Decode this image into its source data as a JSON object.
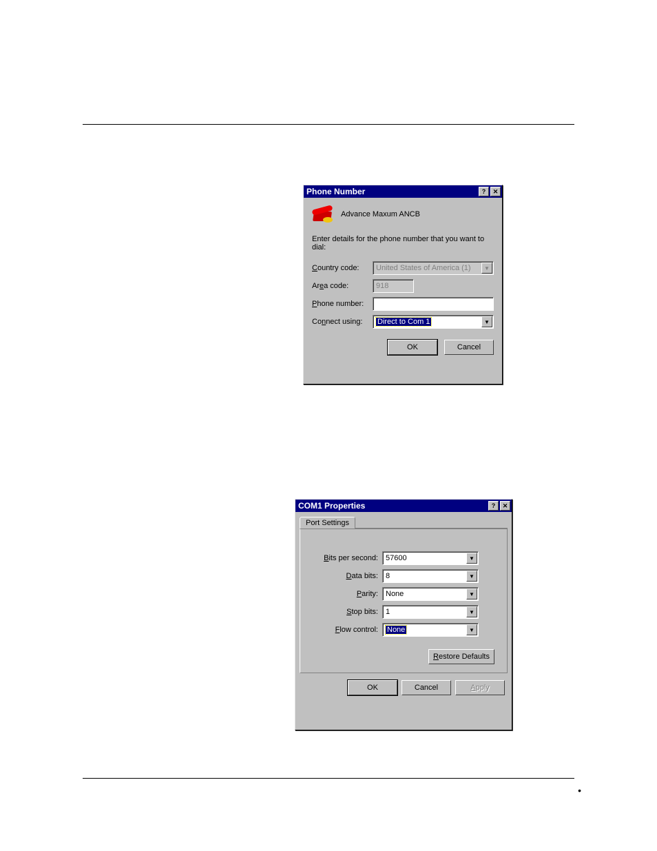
{
  "phone_dialog": {
    "title": "Phone Number",
    "icon_name": "Advance Maxum ANCB",
    "instruction": "Enter details for the phone number that you want to dial:",
    "country": {
      "label": "Country code:",
      "value": "United States of America (1)"
    },
    "area": {
      "label": "Area code:",
      "value": "918"
    },
    "number": {
      "label": "Phone number:",
      "value": ""
    },
    "connect": {
      "label": "Connect using:",
      "value": "Direct to Com 1"
    },
    "ok": "OK",
    "cancel": "Cancel"
  },
  "com_dialog": {
    "title": "COM1 Properties",
    "tab": "Port Settings",
    "bps": {
      "label": "Bits per second:",
      "value": "57600"
    },
    "dbits": {
      "label": "Data bits:",
      "value": "8"
    },
    "parity": {
      "label": "Parity:",
      "value": "None"
    },
    "sbits": {
      "label": "Stop bits:",
      "value": "1"
    },
    "flow": {
      "label": "Flow control:",
      "value": "None"
    },
    "restore": "Restore Defaults",
    "ok": "OK",
    "cancel": "Cancel",
    "apply": "Apply"
  },
  "help_glyph": "?",
  "close_glyph": "✕",
  "dropdown_glyph": "▼",
  "page_dot": "•"
}
